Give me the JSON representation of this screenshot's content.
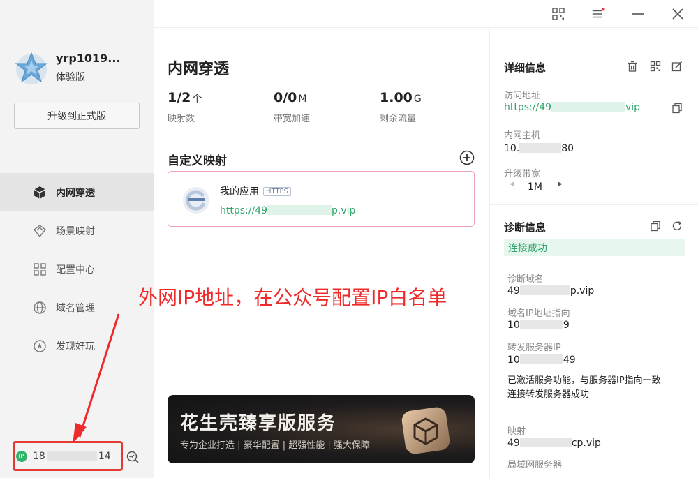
{
  "user": {
    "name": "yrp1019...",
    "plan": "体验版",
    "upgrade_label": "升级到正式版"
  },
  "nav": {
    "items": [
      {
        "label": "内网穿透",
        "icon": "cube-icon",
        "active": true
      },
      {
        "label": "场景映射",
        "icon": "scene-icon",
        "active": false
      },
      {
        "label": "配置中心",
        "icon": "grid-icon",
        "active": false
      },
      {
        "label": "域名管理",
        "icon": "domain-icon",
        "active": false
      },
      {
        "label": "发现好玩",
        "icon": "compass-icon",
        "active": false
      }
    ]
  },
  "ip": {
    "badge": "IP",
    "prefix": "18",
    "suffix": "14"
  },
  "main": {
    "title": "内网穿透",
    "stats": [
      {
        "value": "1/2",
        "unit": "个",
        "label": "映射数"
      },
      {
        "value": "0/0",
        "unit": "M",
        "label": "带宽加速"
      },
      {
        "value": "1.00",
        "unit": "G",
        "label": "剩余流量"
      }
    ],
    "section_title": "自定义映射",
    "mapping": {
      "name": "我的应用",
      "protocol": "HTTPS",
      "url_prefix": "https://49",
      "url_suffix": "p.vip"
    }
  },
  "annotation": "外网IP地址，在公众号配置IP白名单",
  "banner": {
    "title": "花生壳臻享版服务",
    "subtitle": "专为企业打造 | 豪华配置 | 超强性能 | 强大保障"
  },
  "details": {
    "title": "详细信息",
    "access_label": "访问地址",
    "access_prefix": "https://49",
    "access_suffix": "vip",
    "host_label": "内网主机",
    "host_prefix": "10.",
    "host_suffix": "80",
    "bandwidth_label": "升级带宽",
    "bandwidth_value": "1M"
  },
  "diagnosis": {
    "title": "诊断信息",
    "status": "连接成功",
    "domain_label": "诊断域名",
    "domain_prefix": "49",
    "domain_suffix": "p.vip",
    "ip_label": "域名IP地址指向",
    "ip_prefix": "10",
    "ip_suffix": "9",
    "server_label": "转发服务器IP",
    "server_prefix": "10",
    "server_suffix": "49",
    "message_line1": "已激活服务功能，与服务器IP指向一致",
    "message_line2": "连接转发服务器成功",
    "mapping_label": "映射",
    "mapping_prefix": "49",
    "mapping_suffix": "cp.vip",
    "lan_label": "局域网服务器"
  },
  "colors": {
    "accent_green": "#2fa56b",
    "annotation_red": "#ee2a2a",
    "card_border": "#f0a3b8"
  }
}
